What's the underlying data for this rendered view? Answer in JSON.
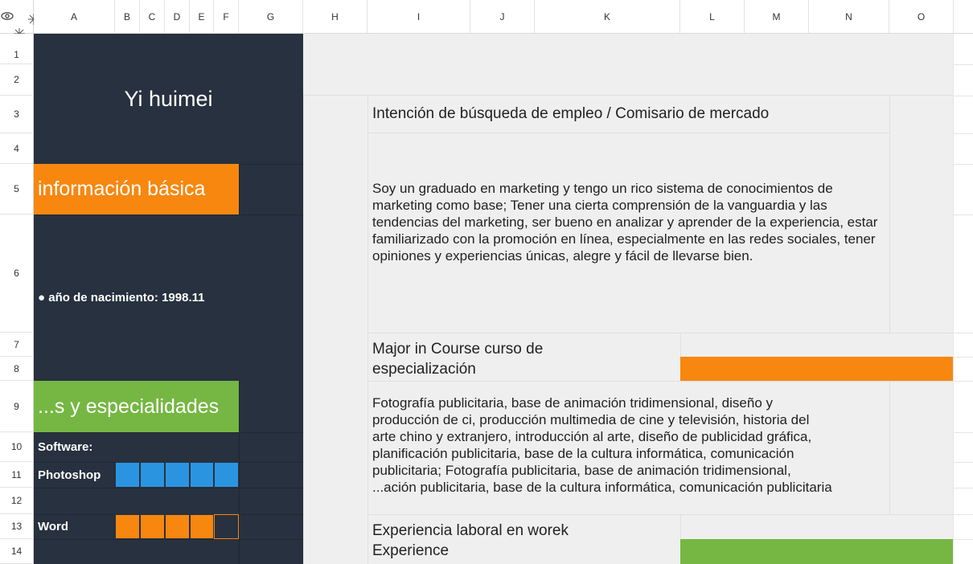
{
  "toolbar": {
    "icon_eye": "eye-icon",
    "icon_freeze_cols": "freeze-columns-icon",
    "icon_freeze_rows": "freeze-rows-icon"
  },
  "columns": [
    "A",
    "B",
    "C",
    "D",
    "E",
    "F",
    "G",
    "H",
    "I",
    "J",
    "K",
    "L",
    "M",
    "N",
    "O"
  ],
  "rows": [
    "1",
    "2",
    "3",
    "4",
    "5",
    "6",
    "7",
    "8",
    "9",
    "10",
    "11",
    "12",
    "13",
    "14"
  ],
  "resume": {
    "name": "Yi huimei",
    "basic_info_title": "información básica",
    "birth": "● año de nacimiento: 1998.11",
    "skills_title": "...s y especialidades",
    "software_label": "Software:",
    "skill1_name": "Photoshop",
    "skill2_name": "Word",
    "job_intention": "Intención de búsqueda de empleo / Comisario de mercado",
    "profile": "Soy un graduado en marketing y tengo un rico sistema de conocimientos de marketing como base; Tener una cierta comprensión de la vanguardia y las tendencias del marketing, ser bueno en analizar y aprender de la experiencia, estar familiarizado con la promoción en línea, especialmente en las redes sociales, tener opiniones y experiencias únicas, alegre y fácil de llevarse bien.",
    "major_title_1": "Major in Course curso de",
    "major_title_2": "especialización",
    "courses_1": "Fotografía publicitaria, base de animación tridimensional, diseño y",
    "courses_2": "producción de ci, producción multimedia de cine y televisión, historia del",
    "courses_3": "arte chino y extranjero, introducción al arte, diseño de publicidad gráfica,",
    "courses_4": "planificación publicitaria, base de la cultura informática, comunicación",
    "courses_5": "publicitaria; Fotografía publicitaria, base de animación tridimensional,",
    "courses_6": "...ación publicitaria, base de la cultura informática, comunicación publicitaria",
    "experience_title_1": "Experiencia laboral en worek",
    "experience_title_2": "Experience"
  },
  "skill_levels": {
    "photoshop": 5,
    "word": 4,
    "scale_max": 5
  },
  "colors": {
    "navy": "#27313f",
    "orange": "#f7870f",
    "green": "#76b743",
    "blue": "#2b94e0",
    "light_gray": "#efefef"
  }
}
